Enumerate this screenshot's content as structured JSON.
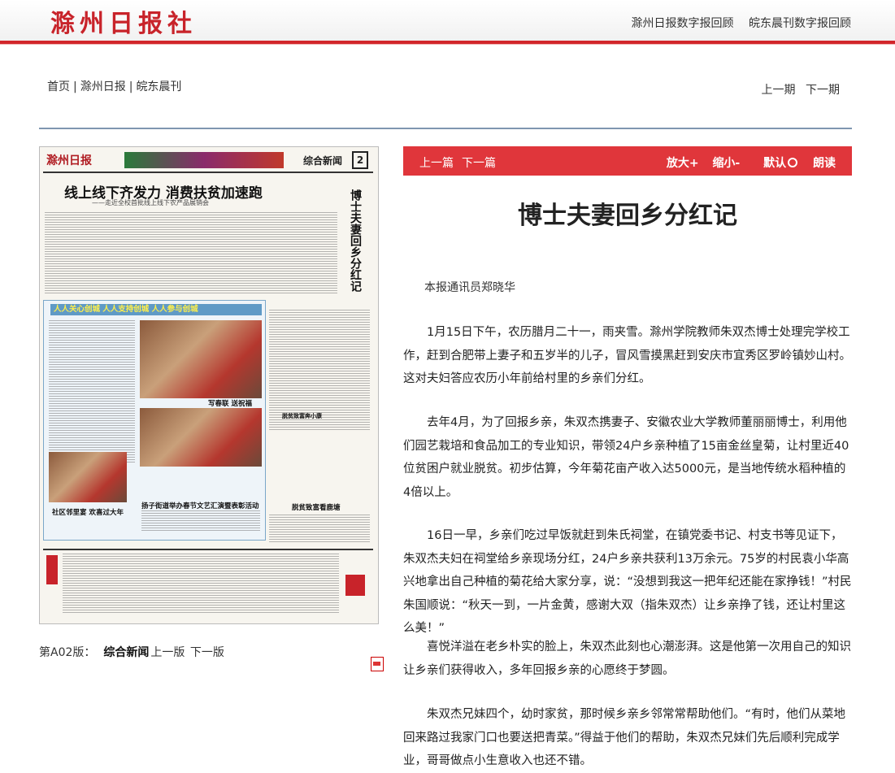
{
  "site": {
    "logo": "滁州日报社",
    "links": [
      "滁州日报数字报回顾",
      "皖东晨刊数字报回顾"
    ]
  },
  "nav": {
    "crumbs": [
      "首页",
      "滁州日报",
      "皖东晨刊"
    ],
    "prev_issue": "上一期",
    "next_issue": "下一期"
  },
  "paper_page": {
    "masthead": "滁州日报",
    "section": "综合新闻",
    "page_number": "2",
    "headline": "线上线下齐发力 消费扶贫加速跑",
    "subheadline": "——走近全校首批线上线下农产品展销会",
    "vertical_headline": "博士夫妻回乡分红记",
    "banner": "人人关心创城 人人支持创城 人人参与创城",
    "caption_a": "写春联 送祝福",
    "caption_b": "扬子街道举办春节文艺汇演暨表彰活动",
    "caption_c": "社区邻里宴 欢喜过大年",
    "caption_d": "脱贫致富奔小康",
    "caption_e": "脱贫致富看鹿塘"
  },
  "page_caption": {
    "edition": "第A02版：",
    "section": "综合新闻",
    "prev": "上一版",
    "next": "下一版"
  },
  "article_bar": {
    "prev": "上一篇",
    "next": "下一篇",
    "zoom_in": "放大+",
    "zoom_out": "缩小-",
    "default": "默认",
    "read": "朗读"
  },
  "article": {
    "title": "博士夫妻回乡分红记",
    "byline": "本报通讯员郑晓华",
    "paragraphs": [
      "1月15日下午，农历腊月二十一，雨夹雪。滁州学院教师朱双杰博士处理完学校工作，赶到合肥带上妻子和五岁半的儿子，冒风雪摸黑赶到安庆市宜秀区罗岭镇妙山村。这对夫妇答应农历小年前给村里的乡亲们分红。",
      "去年4月，为了回报乡亲，朱双杰携妻子、安徽农业大学教师董丽丽博士，利用他们园艺栽培和食品加工的专业知识，带领24户乡亲种植了15亩金丝皇菊，让村里近40位贫困户就业脱贫。初步估算，今年菊花亩产收入达5000元，是当地传统水稻种植的4倍以上。",
      "16日一早，乡亲们吃过早饭就赶到朱氏祠堂，在镇党委书记、村支书等见证下，朱双杰夫妇在祠堂给乡亲现场分红，24户乡亲共获利13万余元。75岁的村民袁小华高兴地拿出自己种植的菊花给大家分享，说：“没想到我这一把年纪还能在家挣钱！”村民朱国顺说：“秋天一到，一片金黄，感谢大双（指朱双杰）让乡亲挣了钱，还让村里这么美！”",
      "喜悦洋溢在老乡朴实的脸上，朱双杰此刻也心潮澎湃。这是他第一次用自己的知识让乡亲们获得收入，多年回报乡亲的心愿终于梦圆。",
      "朱双杰兄妹四个，幼时家贫，那时候乡亲乡邻常常帮助他们。“有时，他们从菜地回来路过我家门口也要送把青菜。”得益于他们的帮助，朱双杰兄妹们先后顺利完成学业，哥哥做点小生意收入也还不错。"
    ]
  },
  "colors": {
    "brand_red": "#d2262b",
    "bar_red": "#e0363b",
    "divider": "#7f96b0"
  }
}
